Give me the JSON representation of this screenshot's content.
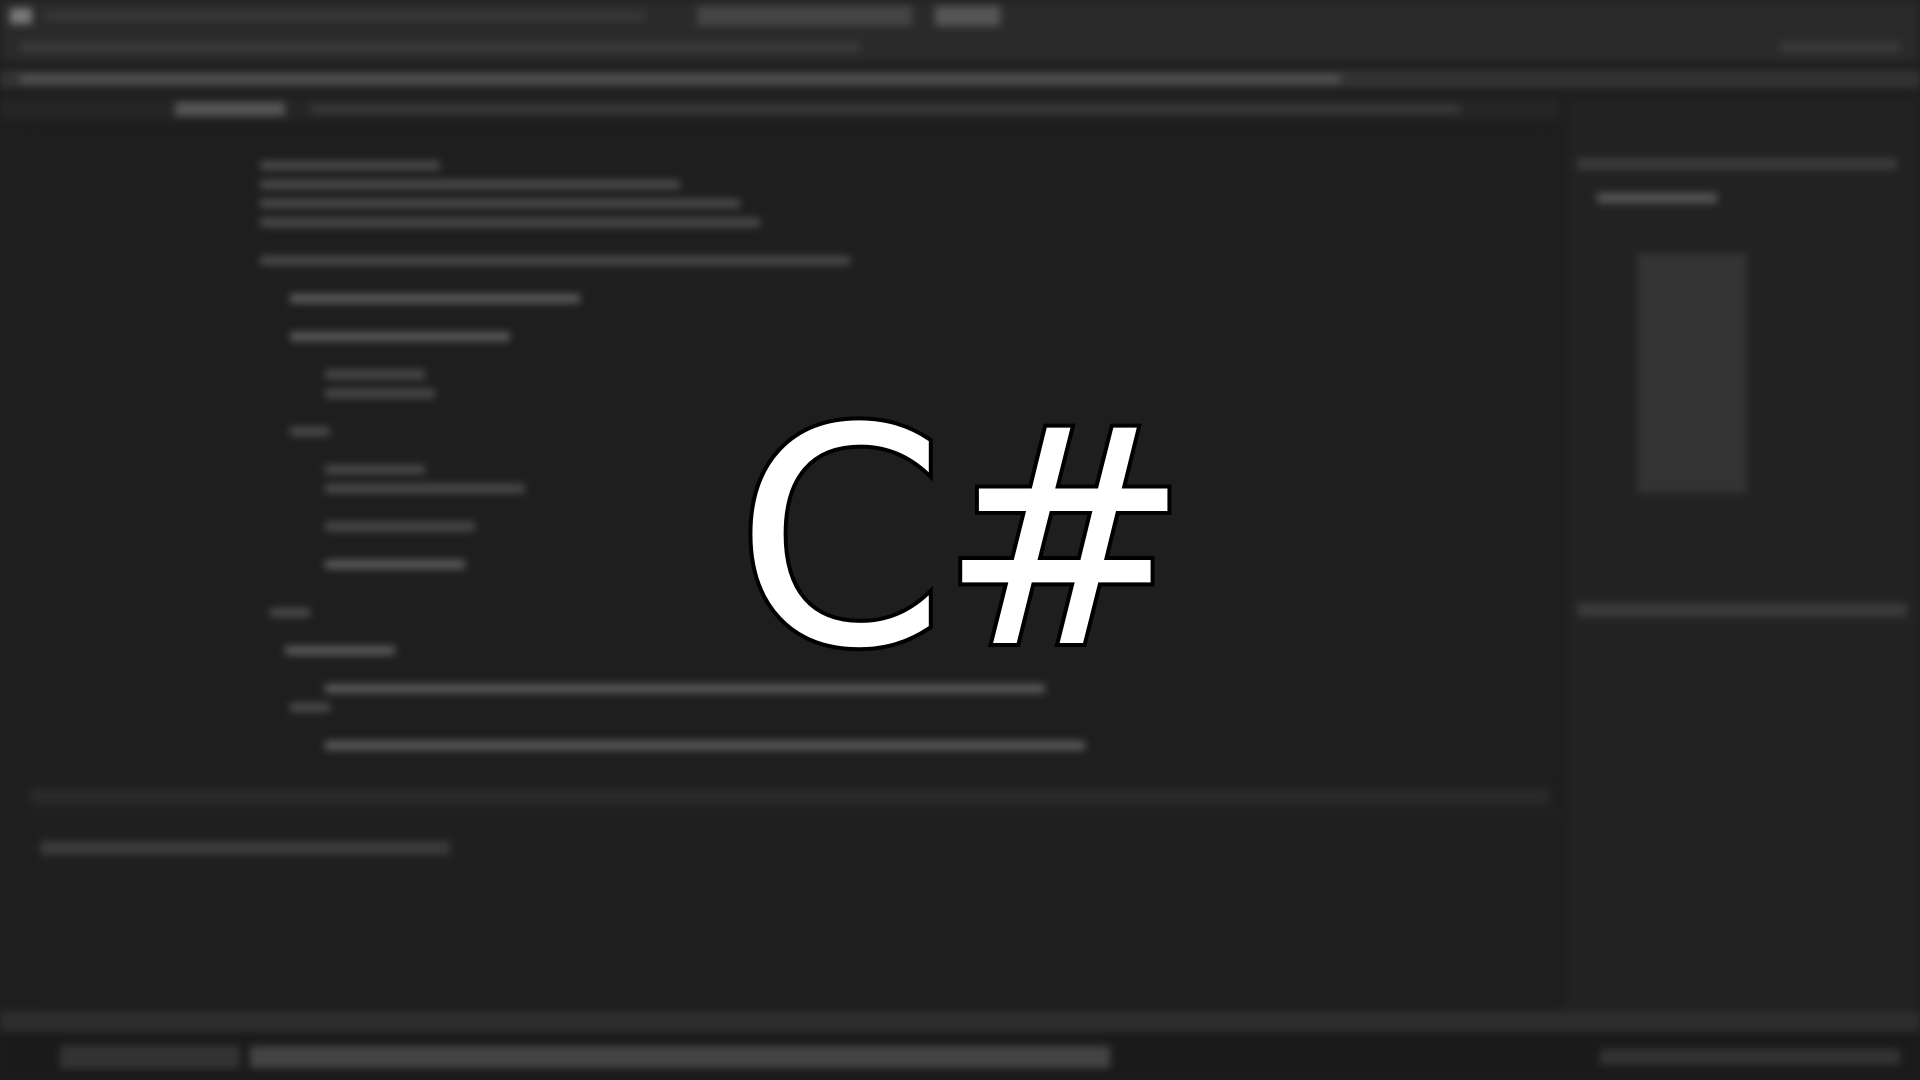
{
  "overlay": {
    "text": "C#"
  },
  "colors": {
    "background": "#1e1e1e",
    "chrome": "#2b2b2b",
    "accent": "#ffffff"
  }
}
